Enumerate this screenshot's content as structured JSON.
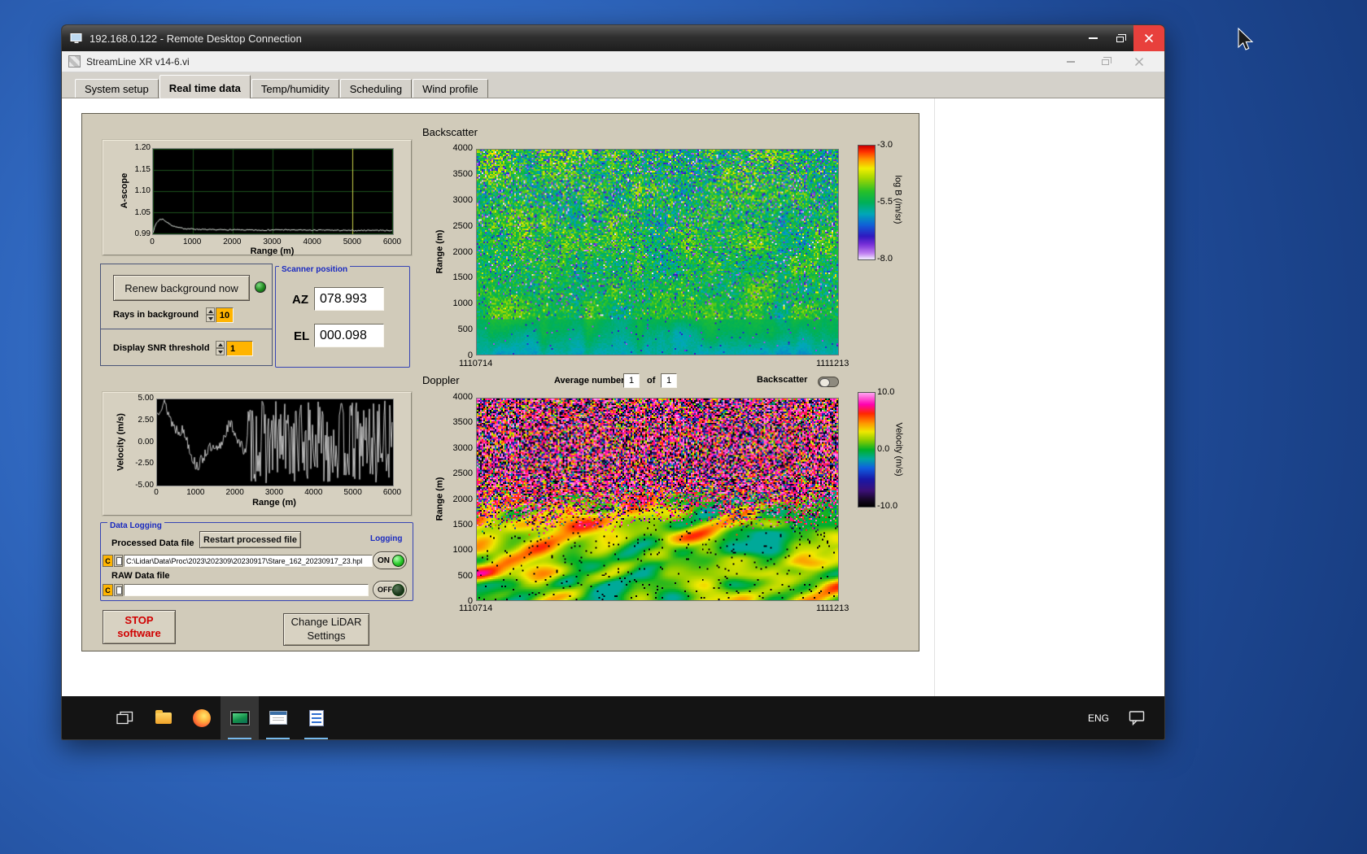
{
  "rdp": {
    "title": "192.168.0.122 - Remote Desktop Connection"
  },
  "vi": {
    "title": "StreamLine XR v14-6.vi",
    "tabs": [
      {
        "label": "System setup",
        "active": false
      },
      {
        "label": "Real time data",
        "active": true
      },
      {
        "label": "Temp/humidity",
        "active": false
      },
      {
        "label": "Scheduling",
        "active": false
      },
      {
        "label": "Wind profile",
        "active": false
      }
    ]
  },
  "panel": {
    "renew_button": "Renew background now",
    "rays_label": "Rays in background",
    "rays_value": "10",
    "snr_label": "Display SNR threshold",
    "snr_value": "1",
    "scanner": {
      "title": "Scanner position",
      "az_label": "AZ",
      "az_value": "078.993",
      "el_label": "EL",
      "el_value": "000.098"
    },
    "backscatter_title": "Backscatter",
    "doppler_title": "Doppler",
    "average_label": "Average number",
    "average_value": "1",
    "of_label": "of",
    "of_count": "1",
    "backscatter_toggle_label": "Backscatter",
    "logging": {
      "title": "Data Logging",
      "processed_label": "Processed Data file",
      "restart_button": "Restart processed file",
      "logging_label": "Logging",
      "drive_label": "C",
      "processed_path": "C:\\Lidar\\Data\\Proc\\2023\\202309\\20230917\\Stare_162_20230917_23.hpl",
      "on_label": "ON",
      "raw_label": "RAW Data file",
      "raw_path": "",
      "off_label": "OFF"
    },
    "stop_line1": "STOP",
    "stop_line2": "software",
    "change_line1": "Change LiDAR",
    "change_line2": "Settings"
  },
  "taskbar": {
    "eng_label": "ENG"
  },
  "chart_data": [
    {
      "id": "a_scope",
      "type": "line",
      "ylabel": "A-scope",
      "xlabel": "Range (m)",
      "yticks": [
        "1.20",
        "1.15",
        "1.10",
        "1.05",
        "0.99"
      ],
      "xticks": [
        "0",
        "1000",
        "2000",
        "3000",
        "4000",
        "5000",
        "6000"
      ],
      "ylim": [
        0.99,
        1.2
      ],
      "xlim": [
        0,
        6000
      ],
      "cursor_x": 5000,
      "noise": 0.0015,
      "points": [
        [
          0,
          0.993
        ],
        [
          80,
          1.015
        ],
        [
          160,
          1.024
        ],
        [
          240,
          1.026
        ],
        [
          320,
          1.02
        ],
        [
          420,
          1.013
        ],
        [
          520,
          1.008
        ],
        [
          650,
          1.004
        ],
        [
          800,
          1.002
        ],
        [
          1000,
          1.001
        ],
        [
          1400,
          0.999
        ],
        [
          2000,
          0.999
        ],
        [
          2600,
          0.998
        ],
        [
          3200,
          0.999
        ],
        [
          3800,
          0.998
        ],
        [
          4400,
          0.998
        ],
        [
          5000,
          0.997
        ],
        [
          5500,
          0.998
        ],
        [
          6000,
          0.997
        ]
      ],
      "colors": {
        "bg": "#000000",
        "grid": "#1d521d",
        "line": "#dde4dd",
        "cursor": "#ccd64a"
      }
    },
    {
      "id": "velocity",
      "type": "line",
      "ylabel": "Velocity (m/s)",
      "xlabel": "Range (m)",
      "yticks": [
        "5.00",
        "2.50",
        "0.00",
        "-2.50",
        "-5.00"
      ],
      "xticks": [
        "0",
        "1000",
        "2000",
        "3000",
        "4000",
        "5000",
        "6000"
      ],
      "ylim": [
        -5,
        5
      ],
      "xlim": [
        0,
        6000
      ],
      "smooth_until_x": 2300,
      "colors": {
        "bg": "#000000",
        "line": "#e8e8e8"
      }
    },
    {
      "id": "backscatter",
      "type": "heatmap",
      "title": "Backscatter",
      "ylabel": "Range (m)",
      "yticks": [
        "4000",
        "3500",
        "3000",
        "2500",
        "2000",
        "1500",
        "1000",
        "500",
        "0"
      ],
      "x_labels": [
        "1110714",
        "1111213"
      ],
      "value_range": [
        -8,
        -3
      ],
      "zones": {
        "smooth_top_frac": 0.17
      },
      "description": "Speckled green aerosol backscatter; smoother teal band below ~700 m; dark blue/purple speckle increases with altitude",
      "colorbar": {
        "label": "log B (/m/sr)",
        "ticks": [
          "-3.0",
          "-5.5",
          "-8.0"
        ],
        "stops": [
          [
            0,
            "#f0e8ff"
          ],
          [
            0.05,
            "#c080f0"
          ],
          [
            0.13,
            "#7830d8"
          ],
          [
            0.2,
            "#3018c0"
          ],
          [
            0.3,
            "#1060d8"
          ],
          [
            0.4,
            "#00a8b8"
          ],
          [
            0.5,
            "#00b058"
          ],
          [
            0.6,
            "#28c028"
          ],
          [
            0.72,
            "#a8d800"
          ],
          [
            0.8,
            "#f0f000"
          ],
          [
            0.88,
            "#ff9800"
          ],
          [
            0.95,
            "#ff3000"
          ],
          [
            1,
            "#cc0000"
          ]
        ]
      }
    },
    {
      "id": "doppler",
      "type": "heatmap",
      "title": "Doppler",
      "ylabel": "Range (m)",
      "yticks": [
        "4000",
        "3500",
        "3000",
        "2500",
        "2000",
        "1500",
        "1000",
        "500",
        "0"
      ],
      "x_labels": [
        "1110714",
        "1111213"
      ],
      "value_range": [
        -10,
        10
      ],
      "zones": {
        "coherent_top_frac": 0.34,
        "transition_frac": 0.2
      },
      "description": "Coherent yellow/orange/green velocity field with red diagonal streaks below ~1500 m; uncorrelated magenta/black noise above",
      "colorbar": {
        "label": "Velocity (m/s)",
        "ticks": [
          "10.0",
          "0.0",
          "-10.0"
        ],
        "stops": [
          [
            0,
            "#000000"
          ],
          [
            0.06,
            "#180828"
          ],
          [
            0.14,
            "#3c1078"
          ],
          [
            0.24,
            "#1818a8"
          ],
          [
            0.34,
            "#1060e0"
          ],
          [
            0.42,
            "#00a8a0"
          ],
          [
            0.5,
            "#00b028"
          ],
          [
            0.58,
            "#88cc00"
          ],
          [
            0.66,
            "#f0e800"
          ],
          [
            0.74,
            "#ff9000"
          ],
          [
            0.82,
            "#ff2800"
          ],
          [
            0.9,
            "#ff00b0"
          ],
          [
            1,
            "#ffa0f0"
          ]
        ]
      }
    }
  ]
}
